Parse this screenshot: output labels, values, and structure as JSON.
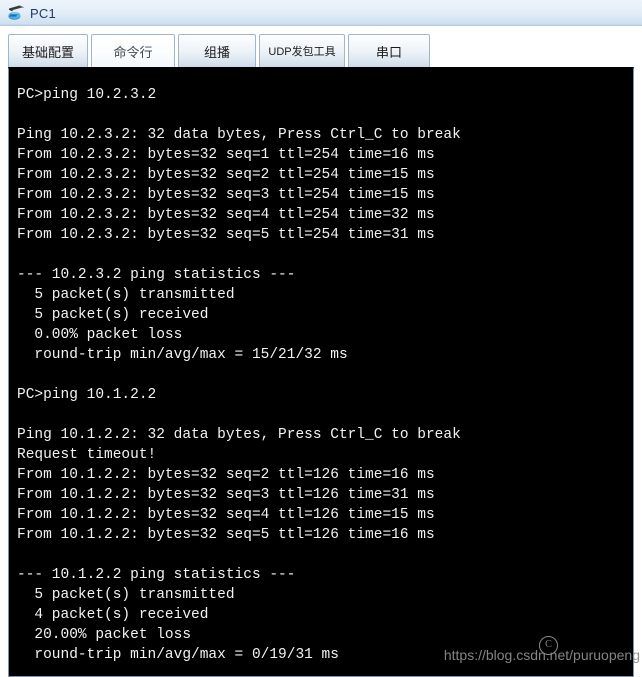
{
  "window": {
    "title": "PC1",
    "icon": "network-device-icon"
  },
  "tabs": [
    {
      "label": "基础配置",
      "selected": false
    },
    {
      "label": "命令行",
      "selected": true
    },
    {
      "label": "组播",
      "selected": false
    },
    {
      "label": "UDP发包工具",
      "selected": false
    },
    {
      "label": "串口",
      "selected": false
    }
  ],
  "terminal": {
    "lines": [
      "PC>ping 10.2.3.2",
      "",
      "Ping 10.2.3.2: 32 data bytes, Press Ctrl_C to break",
      "From 10.2.3.2: bytes=32 seq=1 ttl=254 time=16 ms",
      "From 10.2.3.2: bytes=32 seq=2 ttl=254 time=15 ms",
      "From 10.2.3.2: bytes=32 seq=3 ttl=254 time=15 ms",
      "From 10.2.3.2: bytes=32 seq=4 ttl=254 time=32 ms",
      "From 10.2.3.2: bytes=32 seq=5 ttl=254 time=31 ms",
      "",
      "--- 10.2.3.2 ping statistics ---",
      "  5 packet(s) transmitted",
      "  5 packet(s) received",
      "  0.00% packet loss",
      "  round-trip min/avg/max = 15/21/32 ms",
      "",
      "PC>ping 10.1.2.2",
      "",
      "Ping 10.1.2.2: 32 data bytes, Press Ctrl_C to break",
      "Request timeout!",
      "From 10.1.2.2: bytes=32 seq=2 ttl=126 time=16 ms",
      "From 10.1.2.2: bytes=32 seq=3 ttl=126 time=31 ms",
      "From 10.1.2.2: bytes=32 seq=4 ttl=126 time=15 ms",
      "From 10.1.2.2: bytes=32 seq=5 ttl=126 time=16 ms",
      "",
      "--- 10.1.2.2 ping statistics ---",
      "  5 packet(s) transmitted",
      "  4 packet(s) received",
      "  20.00% packet loss",
      "  round-trip min/avg/max = 0/19/31 ms"
    ]
  },
  "watermark": {
    "text": "https://blog.csdn.net/puruopeng",
    "logo": "C"
  },
  "colors": {
    "terminal_bg": "#000000",
    "terminal_fg": "#f2f2f2",
    "title_text": "#1f3a63",
    "watermark": "#8c8c8c"
  }
}
